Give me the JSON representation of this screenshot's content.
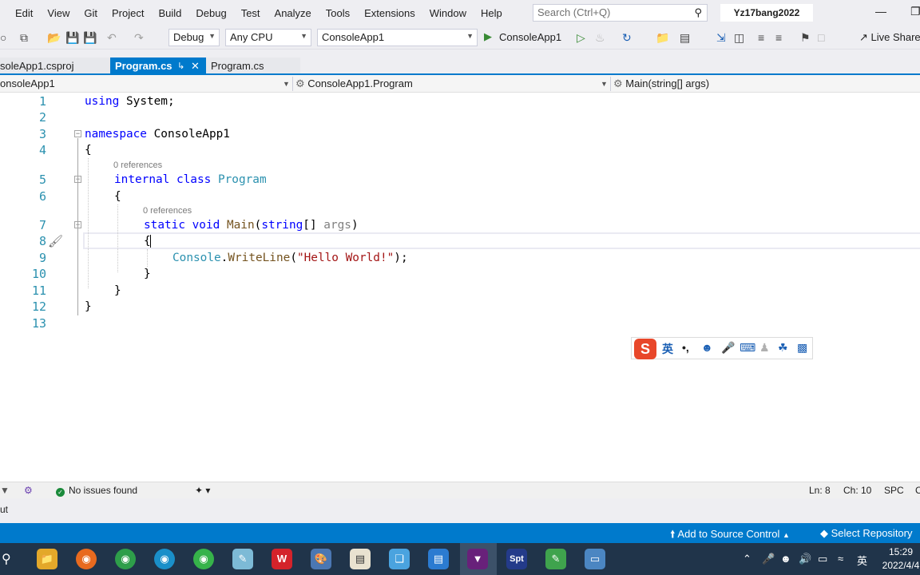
{
  "menu": {
    "items": [
      "Edit",
      "View",
      "Git",
      "Project",
      "Build",
      "Debug",
      "Test",
      "Analyze",
      "Tools",
      "Extensions",
      "Window",
      "Help"
    ],
    "search_placeholder": "Search (Ctrl+Q)",
    "solution_name": "Yz17bang2022"
  },
  "toolbar": {
    "config": "Debug",
    "platform": "Any CPU",
    "startup_project": "ConsoleApp1",
    "run_label": "ConsoleApp1",
    "live_share": "Live Share"
  },
  "tabs": [
    {
      "label": "soleApp1.csproj"
    },
    {
      "label": "Program.cs"
    },
    {
      "label": "Program.cs"
    }
  ],
  "navbar": {
    "project": "onsoleApp1",
    "class": "ConsoleApp1.Program",
    "member": "Main(string[] args)"
  },
  "editor": {
    "line_numbers": [
      "1",
      "2",
      "3",
      "4",
      "5",
      "6",
      "7",
      "8",
      "9",
      "10",
      "11",
      "12",
      "13"
    ],
    "refs_class": "0 references",
    "refs_method": "0 references",
    "code": {
      "l1_kw": "using",
      "l1_rest": " System;",
      "l3_kw": "namespace",
      "l3_rest": " ConsoleApp1",
      "l4": "{",
      "l5_kw": "internal class",
      "l5_type": " Program",
      "l6": "{",
      "l7_kw": "static void",
      "l7_method": " Main",
      "l7_open": "(",
      "l7_kw2": "string",
      "l7_arr": "[] ",
      "l7_param": "args",
      "l7_close": ")",
      "l8": "{",
      "l9_type": "Console",
      "l9_dot": ".",
      "l9_method": "WriteLine",
      "l9_open": "(",
      "l9_str": "\"Hello World!\"",
      "l9_close": ");",
      "l10": "}",
      "l11": "}",
      "l12": "}"
    }
  },
  "ime": {
    "logo": "S",
    "lang": "英"
  },
  "status": {
    "issues": "No issues found",
    "line": "Ln: 8",
    "col": "Ch: 10",
    "mode": "SPC",
    "trailing": "C"
  },
  "output": {
    "label": "ut"
  },
  "vs_status": {
    "source_control": "Add to Source Control",
    "repository": "Select Repository"
  },
  "taskbar": {
    "time": "15:29",
    "date": "2022/4/4",
    "ime_lang": "英"
  }
}
